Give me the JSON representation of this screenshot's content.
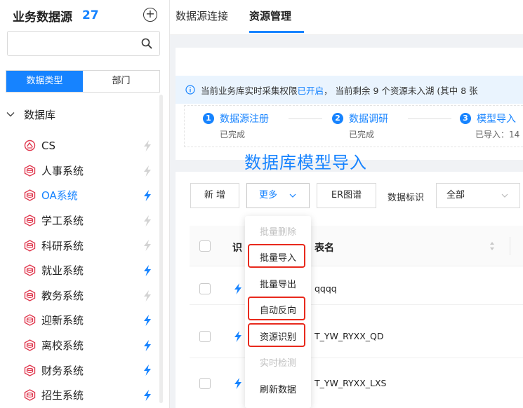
{
  "sidebar": {
    "title": "业务数据源",
    "count": "27",
    "add_icon": "plus-circle-icon",
    "search": {
      "placeholder": "",
      "value": ""
    },
    "tabs": [
      "数据类型",
      "部门"
    ],
    "tree_root": "数据库",
    "items": [
      {
        "label": "CS",
        "active": false,
        "realtime": false,
        "icon": "database-icon-alt"
      },
      {
        "label": "人事系统",
        "active": false,
        "realtime": false,
        "icon": "database-icon"
      },
      {
        "label": "OA系统",
        "active": true,
        "realtime": true,
        "icon": "database-icon"
      },
      {
        "label": "学工系统",
        "active": false,
        "realtime": false,
        "icon": "database-icon"
      },
      {
        "label": "科研系统",
        "active": false,
        "realtime": false,
        "icon": "database-icon"
      },
      {
        "label": "就业系统",
        "active": false,
        "realtime": true,
        "icon": "database-icon"
      },
      {
        "label": "教务系统",
        "active": false,
        "realtime": false,
        "icon": "database-icon"
      },
      {
        "label": "迎新系统",
        "active": false,
        "realtime": true,
        "icon": "database-icon"
      },
      {
        "label": "离校系统",
        "active": false,
        "realtime": true,
        "icon": "database-icon"
      },
      {
        "label": "财务系统",
        "active": false,
        "realtime": true,
        "icon": "database-icon"
      },
      {
        "label": "招生系统",
        "active": false,
        "realtime": true,
        "icon": "database-icon"
      }
    ]
  },
  "topnav": {
    "tabs": [
      "数据源连接",
      "资源管理"
    ],
    "active": "资源管理"
  },
  "notice": {
    "prefix": "当前业务库实时采集权限",
    "status": "已开启",
    "suffix": "，  当前剩余 9 个资源未入湖 (其中 8 张"
  },
  "steps": [
    {
      "num": "1",
      "title": "数据源注册",
      "sub": "已完成"
    },
    {
      "num": "2",
      "title": "数据调研",
      "sub": "已完成"
    },
    {
      "num": "3",
      "title": "模型导入",
      "sub": "已导入：14"
    }
  ],
  "annotation": "数据库模型导入",
  "toolbar": {
    "add": "新 增",
    "more": "更多",
    "er": "ER图谱",
    "tag_label": "数据标识",
    "tag_value": "全部"
  },
  "table": {
    "headers": {
      "id": "识",
      "name": "表名"
    },
    "rows": [
      {
        "realtime": true,
        "name": "qqqq"
      },
      {
        "realtime": true,
        "name": "T_YW_RYXX_QD"
      },
      {
        "realtime": true,
        "name": "T_YW_RYXX_LXS"
      }
    ]
  },
  "more_menu": [
    {
      "label": "批量删除",
      "disabled": true,
      "highlighted": false
    },
    {
      "label": "批量导入",
      "disabled": false,
      "highlighted": true
    },
    {
      "label": "批量导出",
      "disabled": false,
      "highlighted": false
    },
    {
      "label": "自动反向",
      "disabled": false,
      "highlighted": true
    },
    {
      "label": "资源识别",
      "disabled": false,
      "highlighted": true
    },
    {
      "label": "实时检测",
      "disabled": true,
      "highlighted": false
    },
    {
      "label": "刷新数据",
      "disabled": false,
      "highlighted": false
    }
  ],
  "colors": {
    "accent": "#1683ff",
    "db_icon": "#e0394f",
    "bolt_on": "#1683ff",
    "bolt_off": "#d3d3d3",
    "highlight": "#e8291c"
  }
}
